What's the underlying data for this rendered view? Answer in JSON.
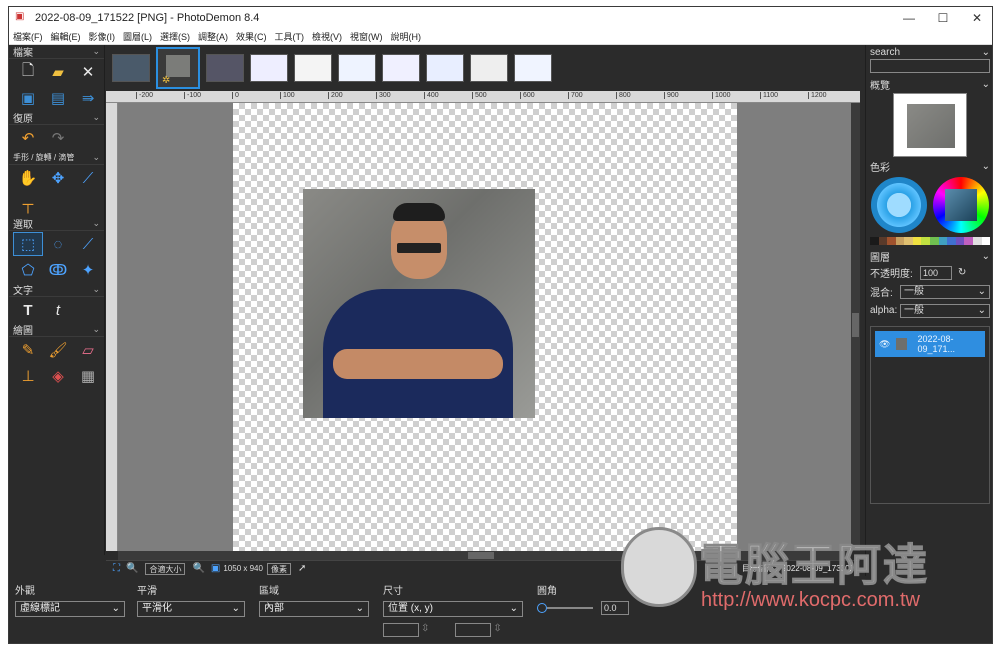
{
  "window": {
    "title": "2022-08-09_171522 [PNG] - PhotoDemon 8.4",
    "controls": [
      "—",
      "☐",
      "✕"
    ]
  },
  "menu": [
    "檔案(F)",
    "編輯(E)",
    "影像(I)",
    "圖層(L)",
    "選擇(S)",
    "調整(A)",
    "效果(C)",
    "工具(T)",
    "檢視(V)",
    "視窗(W)",
    "說明(H)"
  ],
  "left_panel": {
    "sections": {
      "file": "檔案",
      "undo": "復原",
      "hand_move": "手形 / 旋轉 / 滴管",
      "selection": "選取",
      "text": "文字",
      "paint": "繪圖"
    }
  },
  "ruler": {
    "ticks": [
      "-200",
      "-100",
      "0",
      "100",
      "200",
      "300",
      "400",
      "500",
      "600",
      "700",
      "800",
      "900",
      "1000",
      "1100",
      "1200"
    ]
  },
  "status_bar": {
    "zoom": "合適大小",
    "size": "1050 x 940",
    "unit": "像素",
    "right_text": "目標儲存：2022-08-09_173301"
  },
  "right_panel": {
    "search_label": "search",
    "overview_label": "概覽",
    "color_label": "色彩",
    "layers_label": "圖層",
    "opacity_label": "不透明度:",
    "opacity_value": "100",
    "blend_label": "混合:",
    "blend_value": "一般",
    "alpha_label": "alpha:",
    "alpha_value": "一般",
    "layer_name": "2022-08-09_171...",
    "swatch_colors": [
      "#1a1a1a",
      "#5a3a2a",
      "#a0522d",
      "#c8a060",
      "#e0c070",
      "#f0e040",
      "#c0e040",
      "#70c050",
      "#40a0c0",
      "#4070d0",
      "#7050c0",
      "#c060c0",
      "#e0e0e0",
      "#ffffff"
    ]
  },
  "bottom_options": {
    "appearance_label": "外觀",
    "appearance_value": "虛線標記",
    "smooth_label": "平滑",
    "smooth_value": "平滑化",
    "area_label": "區域",
    "area_value": "內部",
    "size_label": "尺寸",
    "size_value": "位置 (x, y)",
    "corner_label": "圓角",
    "corner_value": "0.0"
  },
  "watermark": {
    "line1": "電腦王阿達",
    "line2": "http://www.kocpc.com.tw"
  },
  "colors": {
    "accent": "#2f8ee0",
    "panel_bg": "#2b2b2b",
    "canvas_bg": "#7e7e7e"
  }
}
